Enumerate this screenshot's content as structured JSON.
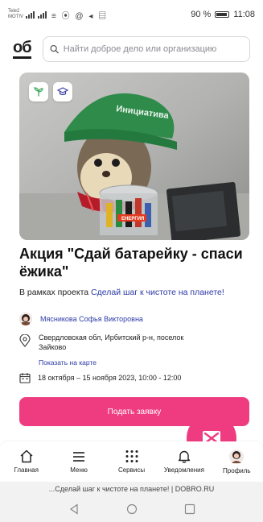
{
  "status_bar": {
    "carrier_line1": "Tele2",
    "carrier_line2": "MOTIV",
    "icons": "≡ ⦿ @ ◂ ▤",
    "battery_text": "90 %",
    "battery_level": 0.9,
    "time": "11:08"
  },
  "header": {
    "logo": "об",
    "search_placeholder": "Найти доброе дело или организацию"
  },
  "event": {
    "badges": [
      "sprout-icon",
      "graduation-cap-icon"
    ],
    "photo_hat_text": "Инициатива",
    "photo_card_text": "ЕНЕРГИЯ",
    "title": "Акция \"Сдай батарейку - спаси ёжика\"",
    "project_prefix": "В рамках проекта",
    "project_link": "Сделай шаг к чистоте на планете!",
    "author": "Мясникова Софья Викторовна",
    "location": "Свердловская обл, Ирбитский р-н, поселок Зайково",
    "map_link": "Показать на карте",
    "dates": "18 октября – 15 ноября 2023, 10:00 - 12:00",
    "apply_button": "Подать заявку"
  },
  "bottom_nav": [
    {
      "label": "Главная",
      "icon": "home-icon"
    },
    {
      "label": "Меню",
      "icon": "menu-icon"
    },
    {
      "label": "Сервисы",
      "icon": "grid-icon"
    },
    {
      "label": "Уведомления",
      "icon": "bell-icon"
    },
    {
      "label": "Профиль",
      "icon": "avatar"
    }
  ],
  "browser": {
    "url_text": "...Сделай шаг к чистоте на планете! | DOBRO.RU"
  },
  "colors": {
    "accent": "#ef3c80",
    "link": "#2c3aa6"
  }
}
